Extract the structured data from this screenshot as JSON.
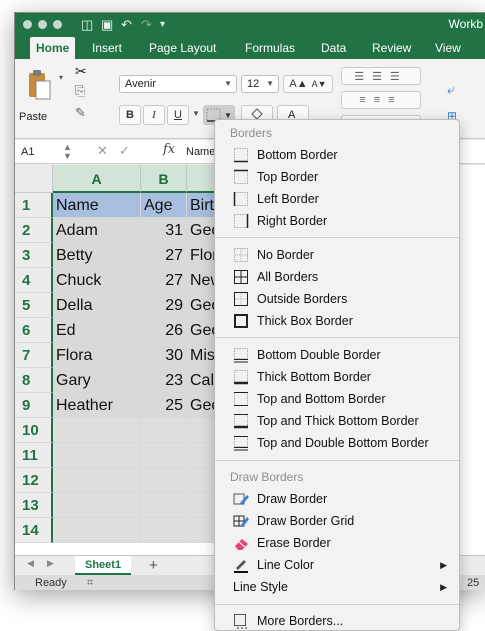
{
  "window": {
    "title": "Workb"
  },
  "tabs": [
    "Home",
    "Insert",
    "Page Layout",
    "Formulas",
    "Data",
    "Review",
    "View"
  ],
  "ribbon": {
    "paste_label": "Paste",
    "font_name": "Avenir",
    "font_size": "12",
    "bold": "B",
    "italic": "I",
    "underline": "U",
    "grow_font": "A▲",
    "shrink_font": "A▼"
  },
  "formula_bar": {
    "name_box": "A1",
    "fx": "fx",
    "content": "Name"
  },
  "sheet": {
    "columns": [
      "A",
      "B"
    ],
    "rows": [
      {
        "num": "1",
        "name": "Name",
        "age": "Age",
        "birth": "Birth"
      },
      {
        "num": "2",
        "name": "Adam",
        "age": "31",
        "birth": "Geor"
      },
      {
        "num": "3",
        "name": "Betty",
        "age": "27",
        "birth": "Florid"
      },
      {
        "num": "4",
        "name": "Chuck",
        "age": "27",
        "birth": "New"
      },
      {
        "num": "5",
        "name": "Della",
        "age": "29",
        "birth": "Geor"
      },
      {
        "num": "6",
        "name": "Ed",
        "age": "26",
        "birth": "Geor"
      },
      {
        "num": "7",
        "name": "Flora",
        "age": "30",
        "birth": "Misso"
      },
      {
        "num": "8",
        "name": "Gary",
        "age": "23",
        "birth": "Califo"
      },
      {
        "num": "9",
        "name": "Heather",
        "age": "25",
        "birth": "Geor"
      },
      {
        "num": "10"
      },
      {
        "num": "11"
      },
      {
        "num": "12"
      },
      {
        "num": "13"
      },
      {
        "num": "14"
      }
    ]
  },
  "sheet_tabs": {
    "active": "Sheet1",
    "add": "+"
  },
  "status": {
    "ready": "Ready",
    "zoom_partial": "25"
  },
  "menu": {
    "section_borders": "Borders",
    "section_draw": "Draw Borders",
    "items": {
      "bottom": "Bottom Border",
      "top": "Top Border",
      "left": "Left Border",
      "right": "Right Border",
      "none": "No Border",
      "all": "All Borders",
      "outside": "Outside Borders",
      "thick_box": "Thick Box Border",
      "bottom_double": "Bottom Double Border",
      "thick_bottom": "Thick Bottom Border",
      "top_bottom": "Top and Bottom Border",
      "top_thick_bottom": "Top and Thick Bottom Border",
      "top_double_bottom": "Top and Double Bottom Border",
      "draw_border": "Draw Border",
      "draw_grid": "Draw Border Grid",
      "erase": "Erase Border",
      "line_color": "Line Color",
      "line_style": "Line Style",
      "more": "More Borders..."
    }
  }
}
